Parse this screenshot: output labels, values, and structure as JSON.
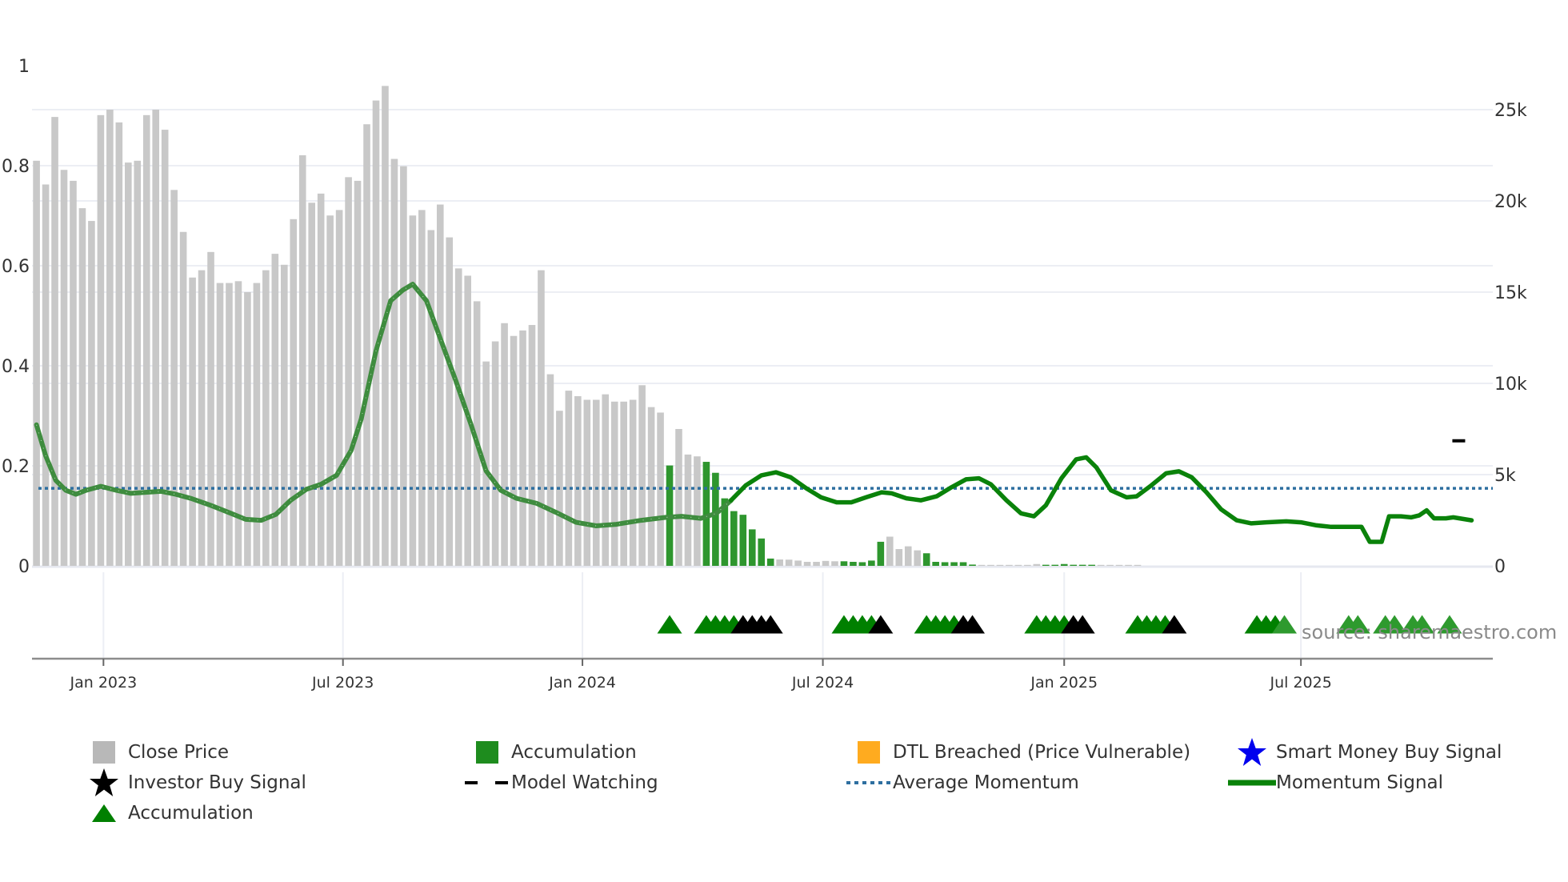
{
  "chart_data": {
    "type": "bar",
    "title": "",
    "x_unit": "week index (weekly bars starting ~Nov 2022)",
    "x_ticks": [
      {
        "label": "Jan 2023",
        "week": 7.3
      },
      {
        "label": "Jul 2023",
        "week": 33.4
      },
      {
        "label": "Jan 2024",
        "week": 59.5
      },
      {
        "label": "Jul 2024",
        "week": 85.7
      },
      {
        "label": "Jan 2025",
        "week": 112.0
      },
      {
        "label": "Jul 2025",
        "week": 137.8
      }
    ],
    "y_left": {
      "range": [
        0,
        1
      ],
      "ticks": [
        "1",
        "0.8",
        "0.6",
        "0.4",
        "0.2",
        "0"
      ],
      "tick_values": [
        1,
        0.8,
        0.6,
        0.4,
        0.2,
        0
      ]
    },
    "y_right": {
      "range": [
        0,
        27000
      ],
      "ticks": [
        "25k",
        "20k",
        "15k",
        "10k",
        "5k",
        "0"
      ],
      "tick_values": [
        25000,
        20000,
        15000,
        10000,
        5000,
        0
      ]
    },
    "close_price_k": [
      22.2,
      20.9,
      24.6,
      21.7,
      21.1,
      19.6,
      18.9,
      24.7,
      25.0,
      24.3,
      22.1,
      22.2,
      24.7,
      25.0,
      23.9,
      20.6,
      18.3,
      15.8,
      16.2,
      17.2,
      15.5,
      15.5,
      15.6,
      15.0,
      15.5,
      16.2,
      17.1,
      16.5,
      19.0,
      22.5,
      19.9,
      20.4,
      19.2,
      19.5,
      21.3,
      21.1,
      24.2,
      25.5,
      26.3,
      22.3,
      21.9,
      19.2,
      19.5,
      18.4,
      19.8,
      18.0,
      16.3,
      15.9,
      14.5,
      11.2,
      12.3,
      13.3,
      12.6,
      12.9,
      13.2,
      16.2,
      10.5,
      8.5,
      9.6,
      9.3,
      9.1,
      9.1,
      9.4,
      9.0,
      9.0,
      9.1,
      9.9,
      8.7,
      8.4,
      5.5,
      7.5,
      6.1,
      6.0,
      5.7,
      5.1,
      3.7,
      3.0,
      2.8,
      2.0,
      1.5,
      0.4,
      0.35,
      0.34,
      0.29,
      0.22,
      0.22,
      0.27,
      0.25,
      0.25,
      0.22,
      0.2,
      0.29,
      1.32,
      1.6,
      0.92,
      1.07,
      0.85,
      0.69,
      0.22,
      0.2,
      0.2,
      0.2,
      0.07,
      0.04,
      0.04,
      0.04,
      0.04,
      0.04,
      0.04,
      0.1,
      0.06,
      0.06,
      0.1,
      0.06,
      0.06,
      0.06,
      0.04,
      0.04,
      0.04,
      0.04,
      0.04
    ],
    "accumulation_weeks": [
      69,
      73,
      74,
      75,
      76,
      77,
      78,
      79,
      80,
      88,
      89,
      90,
      91,
      92,
      97,
      98,
      99,
      100,
      101,
      102,
      110,
      111,
      112,
      113,
      114,
      115
    ],
    "average_momentum": 0.155,
    "momentum_signal": [
      [
        0,
        0.282
      ],
      [
        1,
        0.22
      ],
      [
        2.1,
        0.171
      ],
      [
        3.2,
        0.151
      ],
      [
        4.3,
        0.143
      ],
      [
        5.4,
        0.151
      ],
      [
        7.0,
        0.159
      ],
      [
        8.7,
        0.151
      ],
      [
        10.3,
        0.145
      ],
      [
        11.9,
        0.147
      ],
      [
        13.6,
        0.149
      ],
      [
        15.2,
        0.143
      ],
      [
        16.8,
        0.135
      ],
      [
        19.0,
        0.121
      ],
      [
        21.2,
        0.105
      ],
      [
        22.8,
        0.093
      ],
      [
        24.5,
        0.091
      ],
      [
        26.1,
        0.103
      ],
      [
        27.7,
        0.131
      ],
      [
        29.4,
        0.153
      ],
      [
        31.0,
        0.163
      ],
      [
        32.7,
        0.181
      ],
      [
        34.3,
        0.231
      ],
      [
        35.4,
        0.294
      ],
      [
        37.0,
        0.43
      ],
      [
        38.6,
        0.53
      ],
      [
        39.9,
        0.551
      ],
      [
        41.0,
        0.563
      ],
      [
        42.5,
        0.53
      ],
      [
        44.1,
        0.45
      ],
      [
        45.7,
        0.37
      ],
      [
        47.4,
        0.28
      ],
      [
        49.0,
        0.19
      ],
      [
        50.6,
        0.151
      ],
      [
        52.3,
        0.135
      ],
      [
        54.5,
        0.125
      ],
      [
        56.6,
        0.107
      ],
      [
        58.8,
        0.087
      ],
      [
        61.0,
        0.08
      ],
      [
        63.2,
        0.083
      ],
      [
        65.9,
        0.091
      ],
      [
        68.6,
        0.097
      ],
      [
        70.3,
        0.099
      ],
      [
        72.4,
        0.095
      ],
      [
        74.1,
        0.105
      ],
      [
        75.7,
        0.131
      ],
      [
        77.3,
        0.161
      ],
      [
        79.0,
        0.181
      ],
      [
        80.6,
        0.187
      ],
      [
        82.2,
        0.177
      ],
      [
        83.9,
        0.155
      ],
      [
        85.5,
        0.137
      ],
      [
        87.2,
        0.127
      ],
      [
        88.8,
        0.127
      ],
      [
        90.4,
        0.137
      ],
      [
        92.1,
        0.147
      ],
      [
        93.2,
        0.145
      ],
      [
        94.8,
        0.135
      ],
      [
        96.4,
        0.131
      ],
      [
        98.1,
        0.139
      ],
      [
        99.7,
        0.157
      ],
      [
        101.3,
        0.173
      ],
      [
        102.7,
        0.175
      ],
      [
        104.0,
        0.163
      ],
      [
        105.7,
        0.131
      ],
      [
        107.3,
        0.105
      ],
      [
        108.7,
        0.099
      ],
      [
        110.0,
        0.121
      ],
      [
        111.7,
        0.175
      ],
      [
        113.3,
        0.213
      ],
      [
        114.4,
        0.217
      ],
      [
        115.5,
        0.197
      ],
      [
        117.1,
        0.151
      ],
      [
        118.8,
        0.137
      ],
      [
        119.9,
        0.139
      ],
      [
        121.5,
        0.161
      ],
      [
        123.1,
        0.185
      ],
      [
        124.5,
        0.189
      ],
      [
        125.9,
        0.177
      ],
      [
        127.5,
        0.147
      ],
      [
        129.1,
        0.113
      ],
      [
        130.8,
        0.091
      ],
      [
        132.4,
        0.085
      ],
      [
        134.0,
        0.087
      ],
      [
        136.2,
        0.089
      ],
      [
        137.8,
        0.087
      ],
      [
        139.5,
        0.081
      ],
      [
        141.1,
        0.078
      ],
      [
        144.4,
        0.078
      ],
      [
        145.3,
        0.048
      ],
      [
        146.6,
        0.048
      ],
      [
        147.4,
        0.099
      ],
      [
        148.7,
        0.099
      ],
      [
        149.8,
        0.097
      ],
      [
        150.7,
        0.101
      ],
      [
        151.5,
        0.111
      ],
      [
        152.3,
        0.095
      ],
      [
        153.6,
        0.095
      ],
      [
        154.4,
        0.097
      ],
      [
        156.4,
        0.091
      ]
    ],
    "momentum_highlight_from_week": 75,
    "accumulation_triangles": [
      69,
      73,
      74,
      75,
      76,
      88,
      89,
      90,
      91,
      97,
      98,
      99,
      100,
      109,
      110,
      111,
      112,
      120,
      121,
      122,
      123,
      133,
      134,
      135
    ],
    "accumulation_triangles_light": [
      136,
      143,
      144,
      147,
      148,
      150,
      151,
      154
    ],
    "investor_buy_signals": [
      77,
      78,
      79,
      80,
      92,
      101,
      102,
      113,
      114,
      124
    ],
    "model_watching": [
      {
        "week": 155,
        "value": 0.25
      }
    ],
    "legend_placement": "bottom",
    "source": "source: sharemaestro.com"
  },
  "colors": {
    "close_price": "#c8c8c8",
    "accumulation_bar": "#2e962e",
    "accumulation_triangle": "#008000",
    "accumulation_triangle_light": "#2e9a2e",
    "dtl": "#ffab1f",
    "smart_money": "#0000ee",
    "investor": "#000000",
    "avg_momentum": "#2e6fa0",
    "momentum_early": "#3f8c3f",
    "momentum": "#0a820a"
  },
  "legend": {
    "close_price": "Close Price",
    "accumulation_bar": "Accumulation",
    "dtl": "DTL Breached (Price Vulnerable)",
    "smart_money": "Smart Money Buy Signal",
    "investor": "Investor Buy Signal",
    "model_watching": "Model Watching",
    "avg_momentum": "Average Momentum",
    "momentum": "Momentum Signal",
    "accumulation_triangle": "Accumulation"
  }
}
